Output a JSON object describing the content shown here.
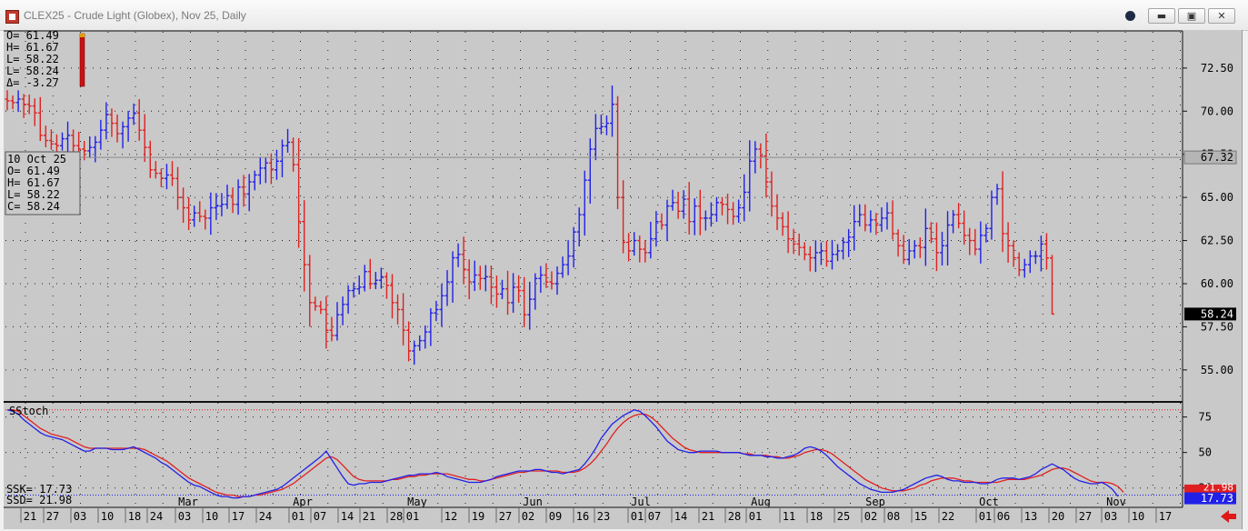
{
  "window": {
    "title": "CLEX25 - Crude Light (Globex), Nov 25, Daily",
    "buttons": [
      {
        "name": "record-icon",
        "label": ""
      },
      {
        "name": "minimize-button",
        "label": "▬"
      },
      {
        "name": "restore-button",
        "label": "▣"
      },
      {
        "name": "close-button",
        "label": "✕"
      }
    ]
  },
  "ohlc_box": {
    "lines": [
      "O=  61.49",
      "H=  61.67",
      "L=  58.22",
      "L=  58.24",
      "Δ=  -3.27"
    ]
  },
  "cursor_box": {
    "lines": [
      "10 Oct 25",
      "O=   61.49",
      "H=   61.67",
      "L=   58.22",
      "C=   58.24"
    ]
  },
  "price_axis": {
    "labels": [
      "72.50",
      "70.00",
      "67.50",
      "65.00",
      "62.50",
      "60.00",
      "57.50",
      "55.00"
    ],
    "cursor_marker": "67.32",
    "last_price_marker": "58.24"
  },
  "stoch_panel": {
    "label": "SStoch",
    "readout": [
      "SSK=   17.73",
      "SSD=   21.98"
    ],
    "axis_labels": [
      "75",
      "50",
      "25"
    ],
    "ssk_marker": "17.73",
    "ssd_marker": "21.98"
  },
  "x_axis": {
    "day_labels": [
      "21",
      "27",
      "03",
      "10",
      "18",
      "24",
      "03",
      "10",
      "17",
      "24",
      "01",
      "07",
      "14",
      "21",
      "28",
      "01",
      "12",
      "19",
      "27",
      "02",
      "09",
      "16",
      "23",
      "01",
      "07",
      "14",
      "21",
      "28",
      "01",
      "11",
      "18",
      "25",
      "02",
      "08",
      "15",
      "22",
      "01",
      "06",
      "13",
      "20",
      "27",
      "03",
      "10",
      "17"
    ],
    "month_labels": [
      "Mar",
      "Apr",
      "May",
      "Jun",
      "Jul",
      "Aug",
      "Sep",
      "Oct",
      "Nov"
    ]
  },
  "colors": {
    "up_bar": "#2020e8",
    "down_bar": "#e02020",
    "ssk_line": "#2020e8",
    "ssd_line": "#e02020",
    "background": "#c9c9c9",
    "last_price_bg": "#000000"
  },
  "chart_data": [
    {
      "type": "ohlc",
      "title": "CLEX25 - Crude Light (Globex), Nov 25, Daily",
      "ylim": [
        53.2,
        74.6
      ],
      "yticks": [
        72.5,
        70.0,
        67.5,
        65.0,
        62.5,
        60.0,
        57.5,
        55.0
      ],
      "grid": true,
      "closes": [
        70.6,
        70.5,
        70.7,
        70.4,
        70.3,
        69.9,
        68.6,
        68.3,
        68.1,
        68.0,
        68.4,
        68.6,
        68.0,
        67.8,
        67.7,
        67.9,
        68.2,
        68.9,
        69.8,
        69.3,
        68.7,
        69.1,
        69.6,
        69.9,
        68.9,
        67.9,
        66.6,
        66.4,
        66.1,
        66.3,
        66.1,
        65.0,
        64.4,
        63.7,
        64.1,
        63.9,
        63.8,
        64.4,
        64.5,
        64.6,
        65.1,
        64.6,
        65.6,
        65.2,
        65.9,
        66.3,
        66.7,
        67.0,
        66.6,
        67.1,
        68.0,
        68.2,
        66.9,
        63.6,
        61.1,
        58.9,
        58.7,
        58.5,
        57.3,
        57.0,
        58.2,
        58.8,
        59.6,
        59.7,
        59.8,
        60.7,
        60.0,
        60.2,
        60.4,
        59.9,
        58.9,
        58.5,
        57.3,
        56.1,
        56.4,
        56.7,
        57.2,
        58.3,
        58.5,
        59.3,
        60.1,
        61.5,
        61.7,
        60.8,
        60.1,
        60.5,
        60.3,
        60.4,
        59.8,
        59.4,
        59.7,
        58.9,
        59.8,
        59.6,
        58.2,
        59.1,
        60.3,
        60.5,
        60.1,
        60.0,
        60.6,
        61.1,
        61.6,
        63.0,
        64.0,
        66.0,
        67.8,
        69.0,
        69.1,
        69.3,
        70.4,
        65.0,
        62.4,
        61.9,
        62.5,
        62.0,
        61.8,
        62.6,
        63.6,
        63.4,
        64.5,
        64.7,
        64.2,
        64.9,
        63.6,
        64.5,
        63.8,
        63.8,
        64.0,
        64.7,
        64.6,
        64.3,
        63.9,
        64.4,
        65.3,
        67.1,
        67.8,
        67.4,
        65.9,
        64.5,
        63.8,
        63.3,
        62.6,
        62.3,
        62.1,
        61.7,
        61.5,
        61.8,
        61.9,
        61.3,
        61.7,
        61.9,
        62.4,
        62.7,
        63.6,
        64.0,
        63.4,
        63.7,
        63.4,
        63.8,
        64.1,
        62.9,
        62.2,
        61.4,
        61.9,
        62.2,
        62.1,
        63.2,
        62.6,
        61.8,
        62.2,
        63.4,
        64.0,
        63.5,
        62.8,
        62.5,
        62.0,
        62.8,
        63.2,
        65.0,
        65.5,
        62.9,
        62.2,
        61.5,
        60.8,
        61.1,
        61.6,
        61.6,
        62.3,
        61.49,
        58.24
      ]
    },
    {
      "type": "line",
      "title": "SStoch",
      "ylim": [
        12,
        85
      ],
      "yticks": [
        75,
        50,
        25
      ],
      "overbought": 80,
      "oversold": 20,
      "series": [
        {
          "name": "SSK",
          "values": [
            80,
            79,
            77,
            73,
            70,
            67,
            64,
            62,
            61,
            60,
            59,
            57,
            55,
            53,
            51,
            51,
            53,
            53,
            53,
            52,
            52,
            52,
            53,
            54,
            52,
            50,
            48,
            46,
            43,
            41,
            38,
            35,
            32,
            29,
            27,
            26,
            24,
            22,
            20,
            19,
            19,
            18,
            18,
            19,
            19,
            20,
            21,
            22,
            23,
            24,
            26,
            29,
            32,
            35,
            38,
            41,
            44,
            47,
            51,
            45,
            39,
            33,
            28,
            27,
            28,
            28,
            29,
            29,
            29,
            30,
            31,
            32,
            33,
            34,
            34,
            35,
            35,
            35,
            36,
            35,
            33,
            32,
            31,
            30,
            29,
            29,
            29,
            30,
            31,
            33,
            34,
            35,
            36,
            37,
            37,
            37,
            38,
            38,
            37,
            36,
            36,
            35,
            36,
            37,
            38,
            42,
            47,
            53,
            60,
            65,
            70,
            73,
            76,
            78,
            80,
            79,
            76,
            72,
            68,
            63,
            58,
            55,
            52,
            51,
            50,
            50,
            51,
            51,
            51,
            51,
            50,
            50,
            50,
            50,
            49,
            48,
            48,
            48,
            47,
            47,
            46,
            46,
            47,
            48,
            50,
            53,
            54,
            53,
            51,
            48,
            44,
            40,
            37,
            34,
            31,
            28,
            26,
            24,
            23,
            22,
            22,
            22,
            23,
            24,
            26,
            28,
            30,
            32,
            33,
            34,
            33,
            31,
            30,
            30,
            29,
            29,
            29,
            28,
            28,
            29,
            31,
            32,
            32,
            32,
            31,
            32,
            33,
            35,
            38,
            40,
            42,
            40,
            38,
            35,
            32,
            30,
            29,
            28,
            28,
            29,
            27,
            24,
            19
          ]
        },
        {
          "name": "SSD",
          "values": [
            80,
            80,
            79,
            76,
            73,
            70,
            67,
            65,
            63,
            62,
            61,
            60,
            58,
            56,
            54,
            53,
            53,
            53,
            53,
            53,
            53,
            53,
            53,
            53,
            53,
            52,
            50,
            48,
            46,
            44,
            41,
            38,
            35,
            32,
            30,
            28,
            26,
            24,
            22,
            21,
            20,
            20,
            19,
            19,
            19,
            20,
            20,
            21,
            22,
            23,
            24,
            26,
            28,
            31,
            34,
            37,
            40,
            43,
            46,
            47,
            45,
            41,
            37,
            33,
            31,
            30,
            30,
            30,
            30,
            30,
            31,
            31,
            32,
            33,
            33,
            34,
            34,
            35,
            35,
            35,
            35,
            34,
            33,
            32,
            31,
            31,
            30,
            30,
            31,
            32,
            33,
            34,
            35,
            36,
            36,
            37,
            37,
            37,
            37,
            37,
            37,
            36,
            36,
            36,
            37,
            39,
            42,
            46,
            51,
            56,
            62,
            67,
            71,
            74,
            76,
            77,
            77,
            75,
            72,
            68,
            64,
            60,
            57,
            54,
            52,
            51,
            50,
            50,
            50,
            50,
            50,
            50,
            50,
            50,
            49,
            49,
            48,
            48,
            48,
            47,
            47,
            46,
            46,
            47,
            48,
            50,
            51,
            52,
            52,
            51,
            49,
            46,
            43,
            40,
            37,
            34,
            31,
            29,
            27,
            25,
            24,
            23,
            23,
            23,
            24,
            25,
            27,
            28,
            30,
            31,
            32,
            32,
            32,
            31,
            30,
            30,
            29,
            29,
            29,
            29,
            29,
            30,
            31,
            31,
            31,
            31,
            32,
            33,
            34,
            36,
            38,
            39,
            39,
            38,
            36,
            34,
            32,
            30,
            29,
            29,
            29,
            28,
            26,
            22
          ]
        }
      ]
    }
  ]
}
